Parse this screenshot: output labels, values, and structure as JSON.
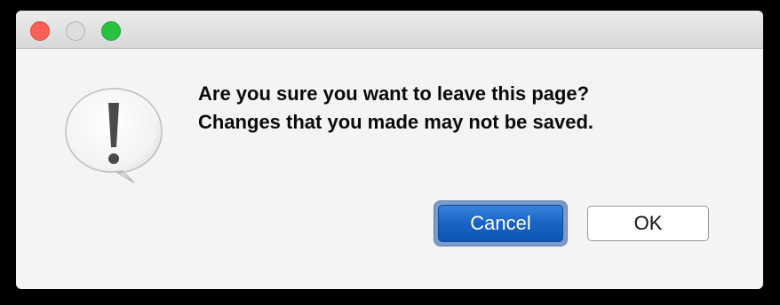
{
  "window": {
    "controls": [
      {
        "name": "close",
        "color": "#fc5f57"
      },
      {
        "name": "minimize",
        "color": "#dedede"
      },
      {
        "name": "zoom",
        "color": "#29c240"
      }
    ]
  },
  "alert": {
    "icon": "exclamation-speech-bubble-icon",
    "message_line1": "Are you sure you want to leave this page?",
    "message_line2": "Changes that you made may not be saved."
  },
  "buttons": {
    "cancel_label": "Cancel",
    "ok_label": "OK"
  },
  "colors": {
    "primary_button": "#1763c4",
    "focus_ring": "#7a9cc8",
    "window_background": "#f4f4f4"
  }
}
